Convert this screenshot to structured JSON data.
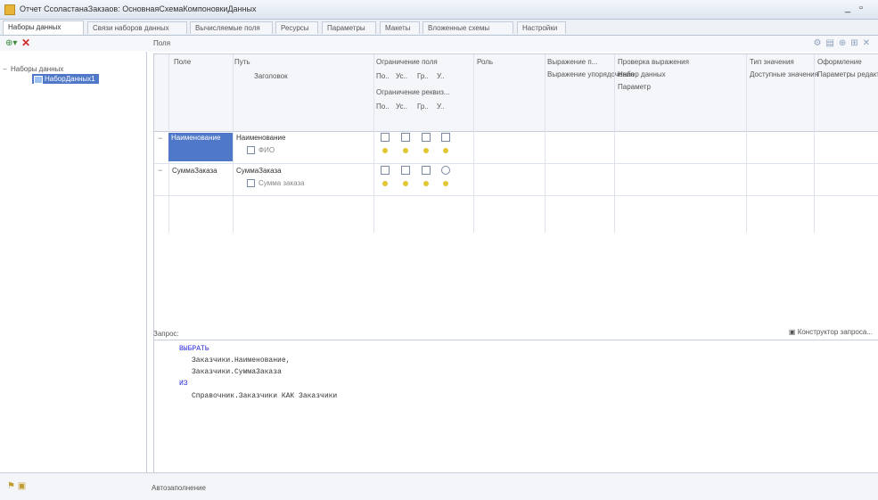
{
  "window": {
    "title": "Отчет СсоластанаЗакзаов: ОсновнаяСхемаКомпоновкиДанных",
    "minimize": "_",
    "maximize": "▫"
  },
  "tabs": [
    "Наборы данных",
    "Связи наборов данных",
    "Вычисляемые поля",
    "Ресурсы",
    "Параметры",
    "Макеты",
    "Вложенные схемы",
    "Настройки"
  ],
  "left": {
    "tree_root": "Наборы данных",
    "tree_child": "НаборДанных1"
  },
  "fields": {
    "label": "Поля",
    "columns": {
      "pole": "Поле",
      "path": "Путь",
      "title": "Заголовок",
      "restrict_field": "Ограничение поля",
      "restrict_attrs": "Ограничение реквиз...",
      "role": "Роль",
      "expr": "Выражение п...",
      "expr_sub": "Выражение упорядочения",
      "check": "Проверка выражения",
      "dataset": "Набор данных",
      "param": "Параметр",
      "valtype": "Тип значения",
      "avail": "Доступные значения",
      "design": "Оформление",
      "design_sub": "Параметры редактирован..."
    },
    "mini": [
      "По..",
      "Ус..",
      "Гр..",
      "У.."
    ],
    "rows": [
      {
        "field": "Наименование",
        "path": "Наименование",
        "title": "ФИО"
      },
      {
        "field": "СуммаЗаказа",
        "path": "СуммаЗаказа",
        "title": "Сумма заказа"
      }
    ]
  },
  "query": {
    "label": "Запрос:",
    "constructor": "Конструктор запроса...",
    "lines": [
      {
        "kw": "ВЫБРАТЬ",
        "rest": ""
      },
      {
        "kw": "",
        "rest": "Заказчики.Наименование,"
      },
      {
        "kw": "",
        "rest": "Заказчики.СуммаЗаказа"
      },
      {
        "kw": "ИЗ",
        "rest": ""
      },
      {
        "kw": "",
        "rest": "Справочник.Заказчики КАК Заказчики"
      }
    ]
  },
  "bottom": {
    "label": "Автозаполнение"
  }
}
